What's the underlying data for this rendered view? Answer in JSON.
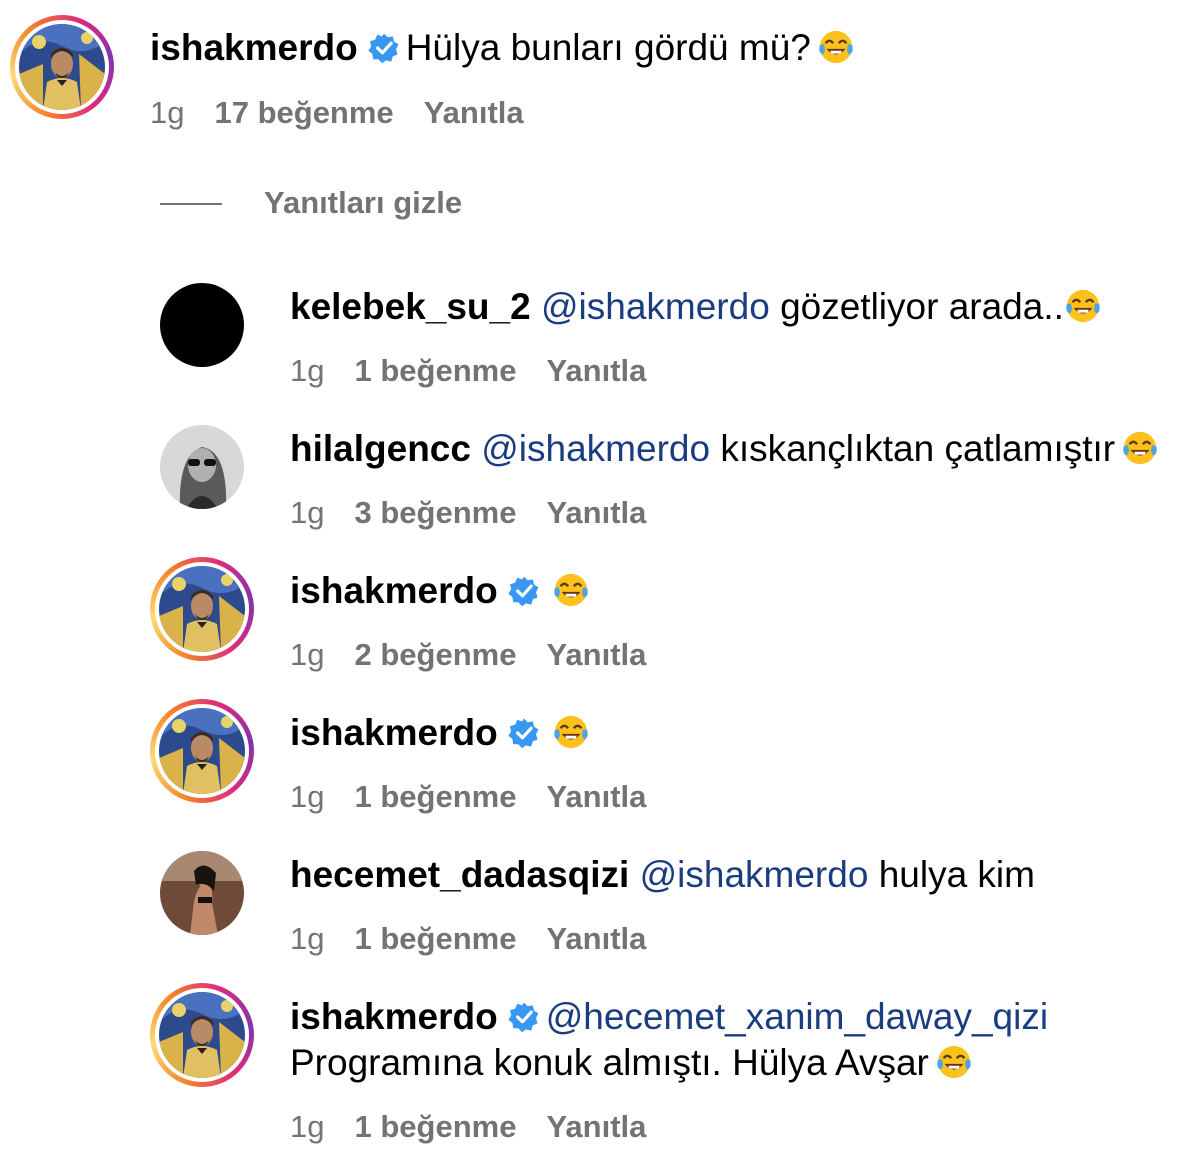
{
  "emoji_name": "face-with-tears-of-joy",
  "accent_color": "#3897f0",
  "mention_color": "#1a3c80",
  "meta_color": "#737373",
  "hide_replies_label": "Yanıtları gizle",
  "comments": [
    {
      "user": "ishakmerdo",
      "verified": true,
      "mention": "",
      "text": "Hülya bunları gördü mü?",
      "text2": "",
      "emoji": true,
      "time": "1g",
      "likes": "17 beğenme",
      "reply": "Yanıtla",
      "avatar": "painted-portrait"
    },
    {
      "user": "kelebek_su_2",
      "verified": false,
      "mention": "@ishakmerdo",
      "text": "gözetliyor arada..",
      "text2": "",
      "emoji": true,
      "time": "1g",
      "likes": "1 beğenme",
      "reply": "Yanıtla",
      "avatar": "black"
    },
    {
      "user": "hilalgencc",
      "verified": false,
      "mention": "@ishakmerdo",
      "text": "kıskançlıktan çatlamıştır",
      "text2": "",
      "emoji": true,
      "time": "1g",
      "likes": "3 beğenme",
      "reply": "Yanıtla",
      "avatar": "grayscale-photo"
    },
    {
      "user": "ishakmerdo",
      "verified": true,
      "mention": "",
      "text": "",
      "text2": "",
      "emoji": true,
      "time": "1g",
      "likes": "2 beğenme",
      "reply": "Yanıtla",
      "avatar": "painted-portrait"
    },
    {
      "user": "ishakmerdo",
      "verified": true,
      "mention": "",
      "text": "",
      "text2": "",
      "emoji": true,
      "time": "1g",
      "likes": "1 beğenme",
      "reply": "Yanıtla",
      "avatar": "painted-portrait"
    },
    {
      "user": "hecemet_dadasqizi",
      "verified": false,
      "mention": "@ishakmerdo",
      "text": "hulya kim",
      "text2": "",
      "emoji": false,
      "time": "1g",
      "likes": "1 beğenme",
      "reply": "Yanıtla",
      "avatar": "dark-photo"
    },
    {
      "user": "ishakmerdo",
      "verified": true,
      "mention": "@hecemet_xanim_daway_qizi",
      "text": "",
      "text2": "Programına konuk almıştı. Hülya Avşar",
      "emoji": true,
      "time": "1g",
      "likes": "1 beğenme",
      "reply": "Yanıtla",
      "avatar": "painted-portrait"
    }
  ]
}
